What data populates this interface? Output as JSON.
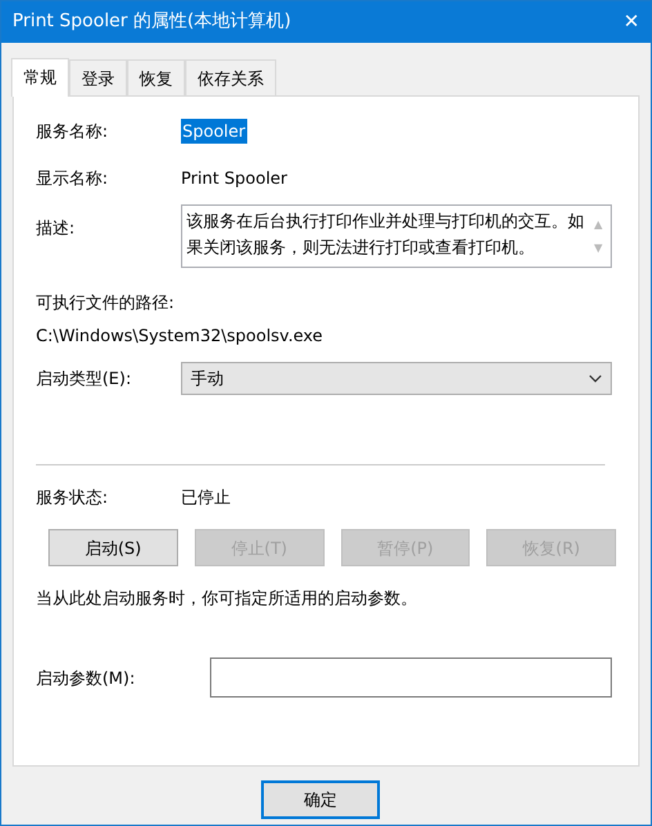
{
  "window": {
    "title": "Print Spooler 的属性(本地计算机)",
    "close": "✕"
  },
  "tabs": [
    {
      "label": "常规",
      "selected": true
    },
    {
      "label": "登录",
      "selected": false
    },
    {
      "label": "恢复",
      "selected": false
    },
    {
      "label": "依存关系",
      "selected": false
    }
  ],
  "service_name": {
    "label": "服务名称:",
    "value": "Spooler",
    "selected": true
  },
  "display_name": {
    "label": "显示名称:",
    "value": "Print Spooler"
  },
  "description": {
    "label": "描述:",
    "value": "该服务在后台执行打印作业并处理与打印机的交互。如果关闭该服务，则无法进行打印或查看打印机。",
    "scroll_up": "▲",
    "scroll_down": "▼"
  },
  "executable_path": {
    "label": "可执行文件的路径:",
    "value": "C:\\Windows\\System32\\spoolsv.exe"
  },
  "startup_type": {
    "label": "启动类型(E):",
    "value": "手动"
  },
  "service_status": {
    "label": "服务状态:",
    "value": "已停止"
  },
  "control_buttons": [
    {
      "label": "启动(S)",
      "disabled": false
    },
    {
      "label": "停止(T)",
      "disabled": true
    },
    {
      "label": "暂停(P)",
      "disabled": true
    },
    {
      "label": "恢复(R)",
      "disabled": true
    }
  ],
  "hint": "当从此处启动服务时，你可指定所适用的启动参数。",
  "start_parameters": {
    "label": "启动参数(M):"
  },
  "footer_buttons": [
    {
      "label": "确定"
    }
  ]
}
